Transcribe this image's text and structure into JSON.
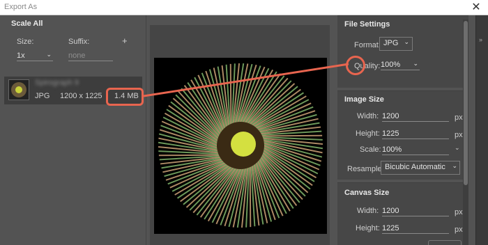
{
  "window": {
    "title": "Export As",
    "close_glyph": "✕"
  },
  "scale": {
    "title": "Scale All",
    "size_label": "Size:",
    "suffix_label": "Suffix:",
    "add_glyph": "+",
    "size_value": "1x",
    "suffix_placeholder": "none"
  },
  "asset": {
    "name": "Spirograph 9",
    "format": "JPG",
    "dimensions": "1200 x 1225",
    "filesize": "1.4 MB"
  },
  "file_settings": {
    "title": "File Settings",
    "format_label": "Format:",
    "format_value": "JPG",
    "quality_label": "Quality:",
    "quality_value": "100%"
  },
  "image_size": {
    "title": "Image Size",
    "width_label": "Width:",
    "width_value": "1200",
    "height_label": "Height:",
    "height_value": "1225",
    "scale_label": "Scale:",
    "scale_value": "100%",
    "resample_label": "Resample:",
    "resample_value": "Bicubic Automatic",
    "unit": "px"
  },
  "canvas_size": {
    "title": "Canvas Size",
    "width_label": "Width:",
    "width_value": "1200",
    "height_label": "Height:",
    "height_value": "1225",
    "unit": "px"
  },
  "colors": {
    "annotation": "#e8654f",
    "panel": "#535353",
    "dark": "#3d3d3d"
  }
}
